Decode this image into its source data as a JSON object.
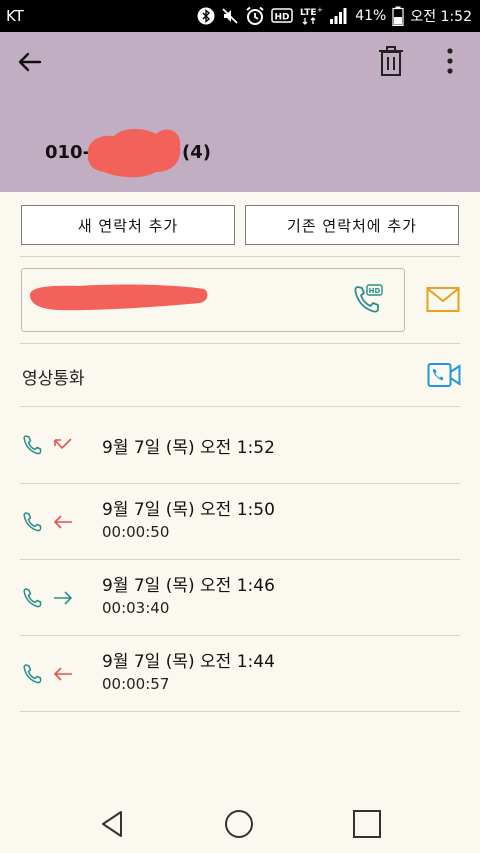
{
  "statusbar": {
    "carrier": "KT",
    "battery": "41%",
    "time": "오전 1:52",
    "icons": [
      "bluetooth-icon",
      "mute-icon",
      "alarm-icon",
      "hd-voice-icon",
      "lte-icon",
      "signal-icon",
      "battery-icon"
    ]
  },
  "header": {
    "number_prefix": "010-",
    "number_suffix": "(4)",
    "accent_color": "#c2aec3"
  },
  "actions": {
    "new_contact": "새 연락처 추가",
    "add_existing": "기존 연락처에 추가"
  },
  "video_call": {
    "label": "영상통화"
  },
  "call_log": [
    {
      "type": "missed",
      "date": "9월 7일 (목) 오전 1:52",
      "duration": ""
    },
    {
      "type": "incoming",
      "date": "9월 7일 (목) 오전 1:50",
      "duration": "00:00:50"
    },
    {
      "type": "outgoing",
      "date": "9월 7일 (목) 오전 1:46",
      "duration": "00:03:40"
    },
    {
      "type": "incoming",
      "date": "9월 7일 (목) 오전 1:44",
      "duration": "00:00:57"
    }
  ],
  "colors": {
    "teal": "#2a8f8a",
    "red": "#e0564f",
    "orange": "#e8a11a",
    "blue": "#1f9ad6",
    "redaction": "#f2625a"
  }
}
